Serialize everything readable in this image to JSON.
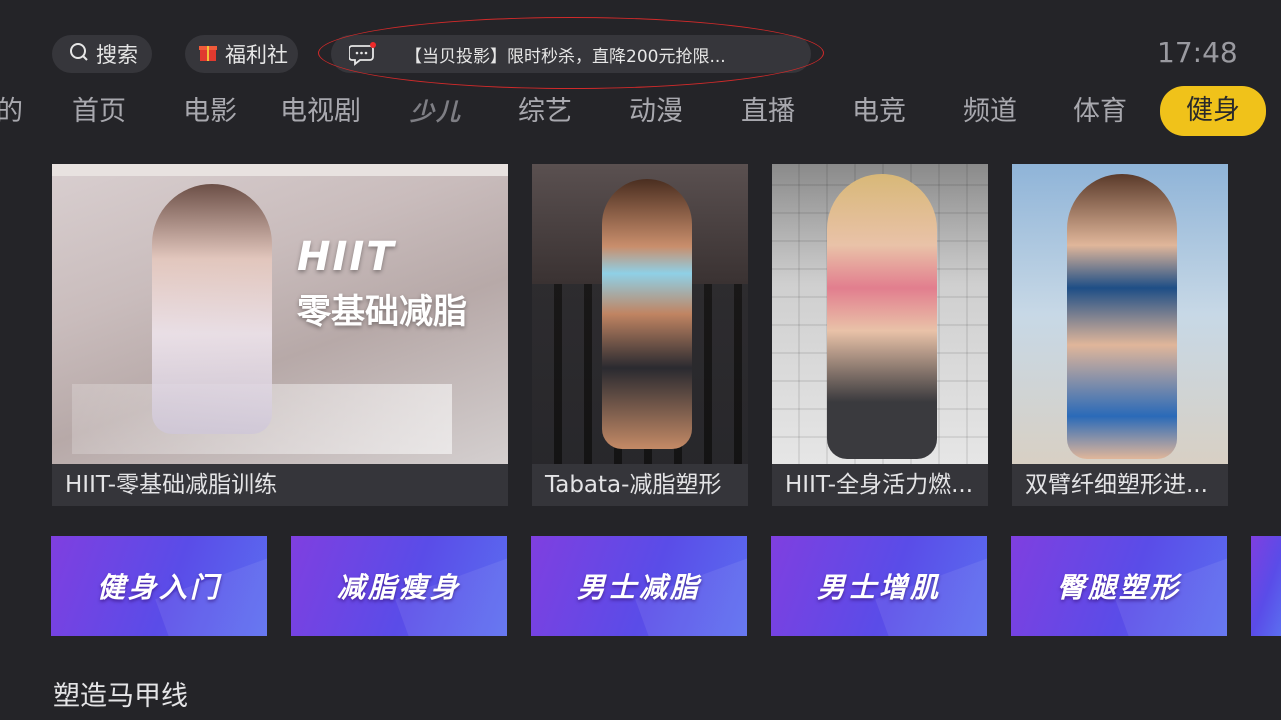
{
  "topbar": {
    "search_label": "搜索",
    "welfare_label": "福利社",
    "notice_text": "【当贝投影】限时秒杀，直降200元抢限...",
    "clock": "17:48"
  },
  "nav": {
    "partial_left": "的",
    "items": [
      "首页",
      "电影",
      "电视剧",
      "少儿",
      "综艺",
      "动漫",
      "直播",
      "电竞",
      "频道",
      "体育",
      "健身"
    ],
    "active": "健身",
    "accent_color": "#f0c21a"
  },
  "cards": [
    {
      "caption": "HIIT-零基础减脂训练",
      "overlay_line1": "HIIT",
      "overlay_line2": "零基础减脂"
    },
    {
      "caption": "Tabata-减脂塑形"
    },
    {
      "caption": "HIIT-全身活力燃..."
    },
    {
      "caption": "双臂纤细塑形进..."
    }
  ],
  "banners": [
    "健身入门",
    "减脂瘦身",
    "男士减脂",
    "男士增肌",
    "臀腿塑形"
  ],
  "section": {
    "title": "塑造马甲线"
  },
  "colors": {
    "background": "#242428",
    "banner_start": "#7f3fe0",
    "banner_end": "#5b6ef0",
    "notice_ring": "#d02a2a"
  }
}
